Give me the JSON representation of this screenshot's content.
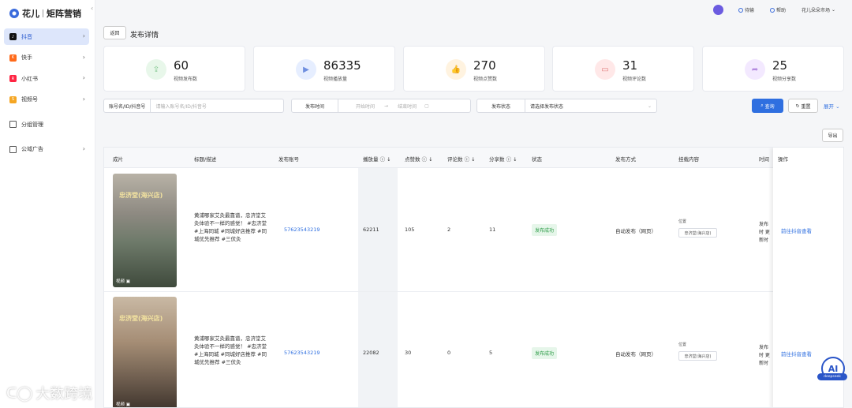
{
  "app": {
    "name": "花儿",
    "module": "矩阵营销"
  },
  "sidebar": {
    "items": [
      {
        "label": "抖音",
        "icon": "douyin-icon",
        "color": "#111111",
        "active": true
      },
      {
        "label": "快手",
        "icon": "kuaishou-icon",
        "color": "#ff6a1a"
      },
      {
        "label": "小红书",
        "icon": "xiaohongshu-icon",
        "color": "#ff2442"
      },
      {
        "label": "视频号",
        "icon": "shipinhao-icon",
        "color": "#f5a623"
      }
    ],
    "group_label": "分组管理",
    "ads_label": "公域广告"
  },
  "header": {
    "todo_label": "待输",
    "help_label": "帮助",
    "user_label": "花儿朵朵市场"
  },
  "page": {
    "back_label": "返回",
    "title": "发布详情"
  },
  "stats": [
    {
      "value": "60",
      "label": "视频发布数",
      "color": "#e8f7ea",
      "icon_color": "#7cc48a",
      "icon": "upload-icon"
    },
    {
      "value": "86335",
      "label": "视频播放量",
      "color": "#e6eeff",
      "icon_color": "#6f8fe0",
      "icon": "play-icon"
    },
    {
      "value": "270",
      "label": "视频点赞数",
      "color": "#fff3e0",
      "icon_color": "#f0b35a",
      "icon": "like-icon"
    },
    {
      "value": "31",
      "label": "视频评论数",
      "color": "#ffe8e8",
      "icon_color": "#e07b7b",
      "icon": "comment-icon"
    },
    {
      "value": "25",
      "label": "视频分享数",
      "color": "#f3e9ff",
      "icon_color": "#b48be0",
      "icon": "share-icon"
    }
  ],
  "filters": {
    "account_label": "账号名/ID/抖音号",
    "account_placeholder": "请输入账号名/ID/抖音号",
    "time_label": "发布时间",
    "start_placeholder": "开始时间",
    "end_placeholder": "结束时间",
    "status_label": "发布状态",
    "status_placeholder": "请选择发布状态",
    "search_label": "查询",
    "reset_label": "重置",
    "expand_label": "展开"
  },
  "export_label": "导出",
  "table": {
    "columns": [
      "成片",
      "标题/描述",
      "发布账号",
      "播放量",
      "点赞数",
      "评论数",
      "分享数",
      "状态",
      "发布方式",
      "挂载内容",
      "时间",
      "操作"
    ],
    "rows": [
      {
        "thumb_title": "忠济堂(海兴店)",
        "thumb_tag": "视频",
        "desc": "黄浦哪家艾灸最靠谱，忠济堂艾灸体验不一样的感觉！ #忠济堂 #上海同城 #同城好店推荐 #同城优先推荐 #三伏灸",
        "account": "57623543219",
        "plays": "62211",
        "likes": "105",
        "comments": "2",
        "shares": "11",
        "status": "发布成功",
        "method": "自动发布（网页）",
        "mount_label": "位置",
        "mount_value": "忠济堂(海兴店)",
        "time": "发布时 更新时",
        "action": "前往抖音查看"
      },
      {
        "thumb_title": "忠济堂(海兴店)",
        "thumb_tag": "视频",
        "desc": "黄浦哪家艾灸最靠谱，忠济堂艾灸体验不一样的感觉！ #忠济堂 #上海同城 #同城好店推荐 #同城优先推荐 #三伏灸",
        "account": "57623543219",
        "plays": "22082",
        "likes": "30",
        "comments": "0",
        "shares": "5",
        "status": "发布成功",
        "method": "自动发布（网页）",
        "mount_label": "位置",
        "mount_value": "忠济堂(海兴店)",
        "time": "发布时 更新时",
        "action": "前往抖音查看"
      }
    ]
  },
  "watermark": "大数跨境",
  "ai": {
    "label": "AI",
    "tag": "deepseek"
  }
}
